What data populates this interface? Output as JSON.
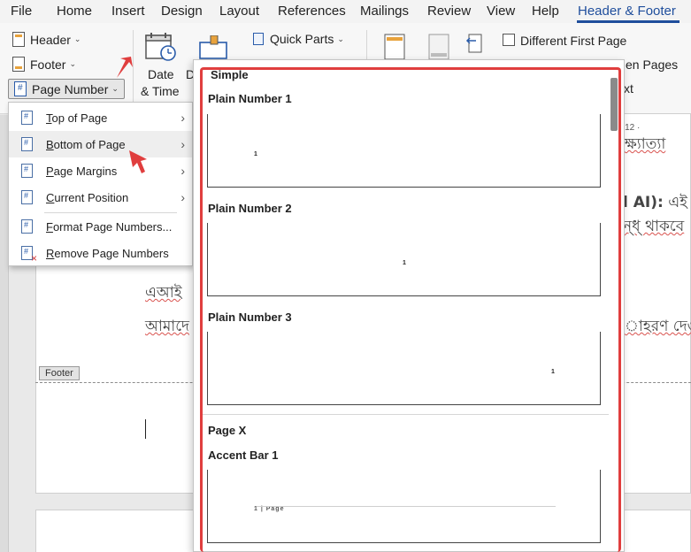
{
  "menu": {
    "tabs": [
      "File",
      "Home",
      "Insert",
      "Design",
      "Layout",
      "References",
      "Mailings",
      "Review",
      "View",
      "Help",
      "Header & Footer"
    ]
  },
  "ribbon": {
    "header_label": "Header",
    "footer_label": "Footer",
    "page_number_label": "Page Number",
    "date_time_line1": "Date",
    "date_time_line2": "& Time",
    "doc_info_partial": "D",
    "quick_parts_label": "Quick Parts",
    "different_first_page": "Different First Page",
    "odd_even_partial": "en Pages",
    "show_doc_text_partial": "xt"
  },
  "page_number_menu": {
    "items": [
      {
        "label": "Top of Page",
        "accel": "T",
        "rest": "op of Page"
      },
      {
        "label": "Bottom of Page",
        "accel": "B",
        "rest": "ottom of Page"
      },
      {
        "label": "Page Margins",
        "accel": "P",
        "rest": "age Margins"
      },
      {
        "label": "Current Position",
        "accel": "C",
        "rest": "urrent Position"
      },
      {
        "label": "Format Page Numbers...",
        "accel": "F",
        "rest": "ormat Page Numbers..."
      },
      {
        "label": "Remove Page Numbers",
        "accel": "R",
        "rest": "emove Page Numbers"
      }
    ]
  },
  "gallery": {
    "section_simple": "Simple",
    "plain1": "Plain Number 1",
    "plain2": "Plain Number 2",
    "plain3": "Plain Number 3",
    "section_pagex": "Page X",
    "accent1": "Accent Bar 1",
    "sample_number": "1",
    "accent_sample": "1 | Page"
  },
  "document": {
    "line1": "ক্ষ্যাত্যা",
    "line2_bold": "l AI):",
    "line2_rest": " এই",
    "line3": "ন্ধ্ থাকবে",
    "line4": "এআই",
    "line5_left": "আমাদে",
    "line5_right": "াহরণ দেও",
    "footer_tag": "Footer",
    "ruler_number": "· 12 ·"
  },
  "colors": {
    "accent_blue": "#1f4e9c",
    "highlight_red": "#e03e3e"
  }
}
